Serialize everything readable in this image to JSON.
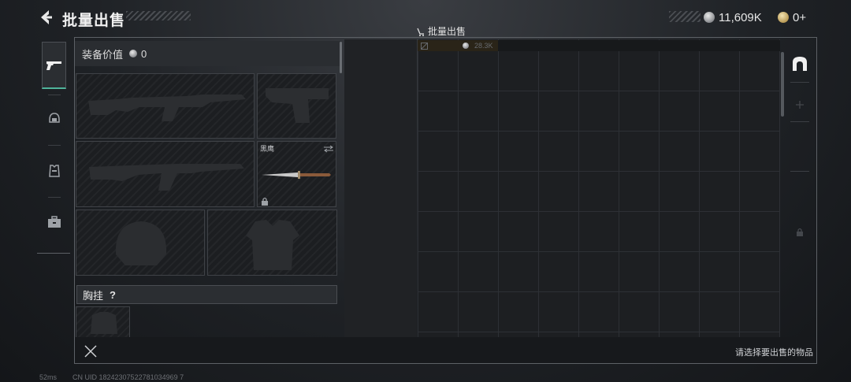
{
  "header": {
    "title": "批量出售",
    "back_icon": "chevron-left-icon"
  },
  "currency": {
    "silver_amount": "11,609K",
    "gold_amount": "0+"
  },
  "bulk_sell_label": "批量出售",
  "sidebar": {
    "tabs": [
      {
        "icon": "pistol-icon",
        "active": true
      },
      {
        "icon": "helmet-icon",
        "active": false
      },
      {
        "icon": "vest-icon",
        "active": false
      },
      {
        "icon": "briefcase-icon",
        "active": false
      }
    ]
  },
  "equipment": {
    "value_label": "装备价值",
    "value": "0",
    "slots": [
      {
        "id": "primary-weapon",
        "icon": "rifle-icon"
      },
      {
        "id": "sidearm",
        "icon": "pistol-icon"
      },
      {
        "id": "secondary-weapon",
        "icon": "rifle-icon"
      },
      {
        "id": "melee",
        "icon": "knife-icon",
        "name": "黑鹰",
        "locked": true
      },
      {
        "id": "helmet",
        "icon": "helmet-icon"
      },
      {
        "id": "body-armor",
        "icon": "armor-icon"
      }
    ],
    "chest_rig_label": "胸挂",
    "chest_rig_help": "?"
  },
  "grid": {
    "capacity_value": "28.3K"
  },
  "footer": {
    "hint": "请选择要出售的物品"
  },
  "status": {
    "ping": "52ms",
    "uid": "CN UID 18242307522781034969 7"
  },
  "colors": {
    "accent": "#4fb39a",
    "background": "#1c1e21",
    "border": "#5d6166"
  }
}
